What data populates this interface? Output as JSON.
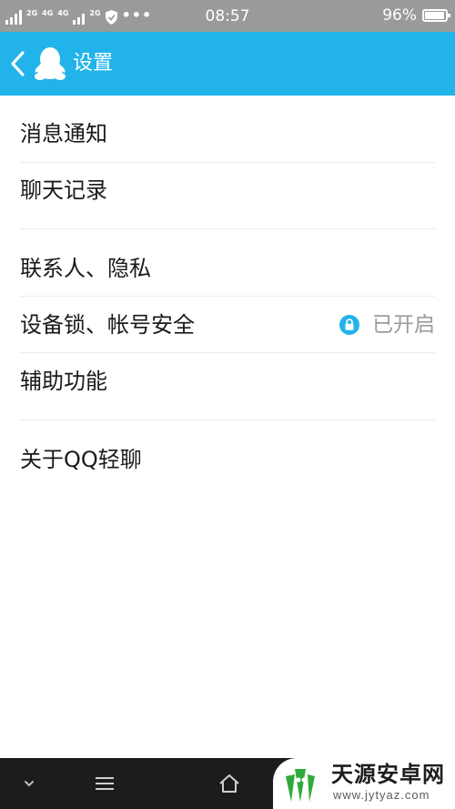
{
  "status_bar": {
    "network_1": "2G",
    "network_2": "4G",
    "network_3": "4G",
    "network_4": "2G",
    "time": "08:57",
    "battery": "96%",
    "battery_level": 0.96
  },
  "app_bar": {
    "back_icon": "chevron-left-icon",
    "logo_icon": "qq-penguin-icon",
    "title": "设置",
    "background": "#21b3ea"
  },
  "settings": {
    "items": [
      {
        "label": "消息通知"
      },
      {
        "label": "聊天记录"
      },
      {
        "label": "联系人、隐私"
      },
      {
        "label": "设备锁、帐号安全",
        "status": "已开启",
        "status_icon": "lock-icon",
        "status_icon_color": "#21b3ea"
      },
      {
        "label": "辅助功能"
      },
      {
        "label": "关于QQ轻聊"
      }
    ]
  },
  "nav_bar": {
    "icons": [
      "chevron-down-icon",
      "menu-icon",
      "home-icon"
    ]
  },
  "watermark": {
    "title": "天源安卓网",
    "url": "www.jytyaz.com"
  }
}
